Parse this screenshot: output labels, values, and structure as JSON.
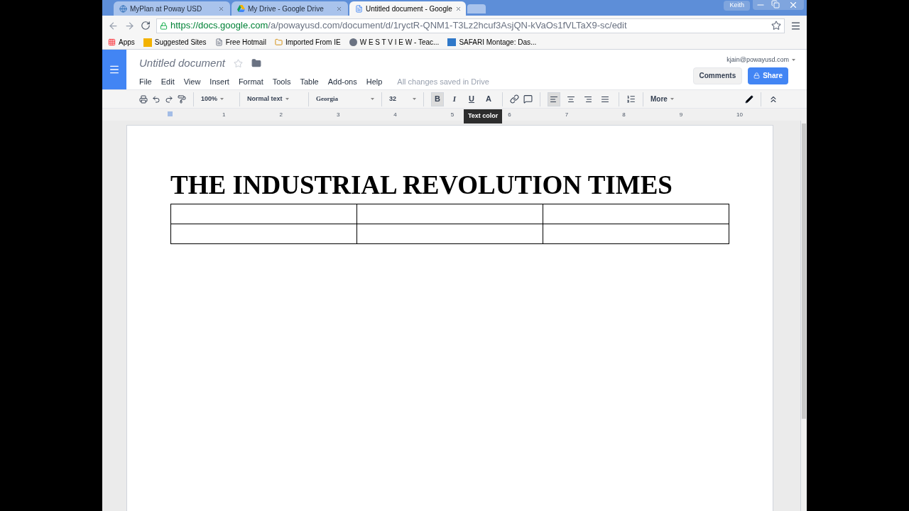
{
  "browser": {
    "tabs": [
      {
        "title": "MyPlan at Poway USD",
        "selected": false
      },
      {
        "title": "My Drive - Google Drive",
        "selected": false
      },
      {
        "title": "Untitled document - Google",
        "selected": true
      }
    ],
    "user": "Keith",
    "url_host": "https://docs.google.com",
    "url_path": "/a/powayusd.com/document/d/1ryctR-QNM1-T3Lz2hcuf3AsjQN-kVaOs1fVLTaX9-sc/edit",
    "bookmarks": [
      "Apps",
      "Suggested Sites",
      "Free Hotmail",
      "Imported From IE",
      "W E S T V I E W - Teac...",
      "SAFARI Montage: Das..."
    ]
  },
  "docs": {
    "title": "Untitled document",
    "menus": [
      "File",
      "Edit",
      "View",
      "Insert",
      "Format",
      "Tools",
      "Table",
      "Add-ons",
      "Help"
    ],
    "save_status": "All changes saved in Drive",
    "account": "kjain@powayusd.com",
    "comments": "Comments",
    "share": "Share",
    "zoom": "100%",
    "style": "Normal text",
    "font": "Georgia",
    "size": "32",
    "more": "More",
    "format_buttons": [
      {
        "label": "B",
        "selected": true
      },
      {
        "label": "I",
        "selected": false
      },
      {
        "label": "U",
        "selected": false
      },
      {
        "label": "A",
        "selected": false
      }
    ],
    "align_buttons": [
      {
        "selected": true
      },
      {
        "selected": false
      },
      {
        "selected": false
      },
      {
        "selected": false
      }
    ],
    "tooltip": "Text color",
    "ruler": [
      "1",
      "2",
      "3",
      "4",
      "5",
      "6",
      "7",
      "8",
      "9",
      "10"
    ]
  },
  "document": {
    "heading": "THE INDUSTRIAL REVOLUTION TIMES",
    "table": {
      "rows": [
        {
          "cells": [
            {},
            {},
            {}
          ]
        },
        {
          "cells": [
            {},
            {},
            {}
          ]
        }
      ]
    }
  }
}
